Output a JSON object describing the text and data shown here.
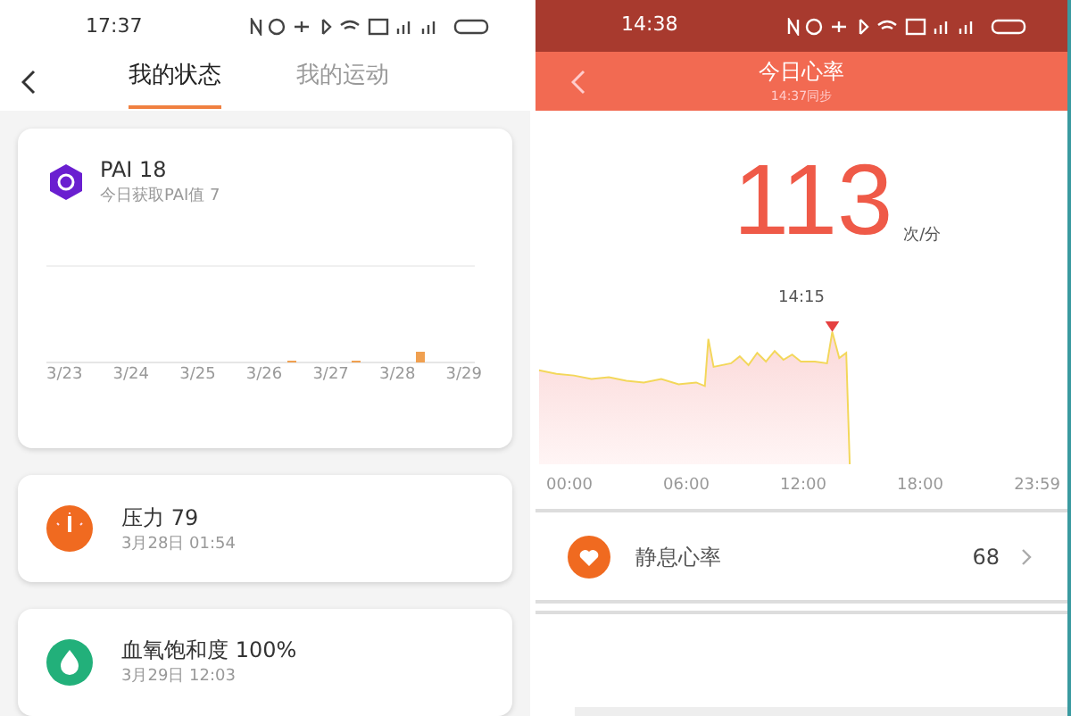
{
  "left": {
    "status_bar": {
      "time": "17:37"
    },
    "tabs": [
      {
        "label": "我的状态",
        "selected": true
      },
      {
        "label": "我的运动",
        "selected": false
      }
    ],
    "pai": {
      "title": "PAI 18",
      "subtitle": "今日获取PAI值 7",
      "days": [
        "3/23",
        "3/24",
        "3/25",
        "3/26",
        "3/27",
        "3/28",
        "3/29"
      ]
    },
    "metrics": [
      {
        "kind": "stress",
        "title": "压力 79",
        "time": "3月28日 01:54"
      },
      {
        "kind": "oxygen",
        "title": "血氧饱和度 100%",
        "time": "3月29日 12:03"
      }
    ]
  },
  "right": {
    "status_bar": {
      "time": "14:38"
    },
    "header": {
      "title": "今日心率",
      "subtitle": "14:37同步"
    },
    "reading": {
      "value": "113",
      "unit": "次/分",
      "time": "14:15"
    },
    "axis": [
      "00:00",
      "06:00",
      "12:00",
      "18:00",
      "23:59"
    ],
    "resting": {
      "label": "静息心率",
      "value": "68"
    }
  }
}
